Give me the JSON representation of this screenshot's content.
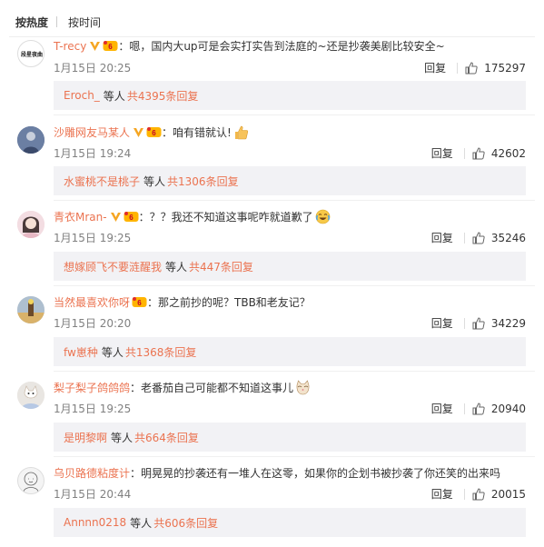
{
  "sort": {
    "hot": "按热度",
    "time": "按时间"
  },
  "comments": [
    {
      "username": "T-recy",
      "text": "：嗯，国内大up可是会实打实告到法庭的~还是抄袭美剧比较安全~",
      "time": "1月15日 20:25",
      "likes": "175297",
      "reply_label": "回复",
      "reply_user": "Eroch_",
      "reply_mid": "等人",
      "reply_count": "共4395条回复",
      "has_v": true,
      "has_vip": true,
      "emoji": "",
      "avatar_text": "段星夜曲"
    },
    {
      "username": "沙雕网友马某人",
      "text": "：咱有错就认!",
      "time": "1月15日 19:24",
      "likes": "42602",
      "reply_label": "回复",
      "reply_user": "水蜜桃不是桃子",
      "reply_mid": "等人",
      "reply_count": "共1306条回复",
      "has_v": true,
      "has_vip": true,
      "emoji": "thumbs-up-emoji",
      "avatar_text": ""
    },
    {
      "username": "青衣Mran-",
      "text": "：？？我还不知道这事呢咋就道歉了",
      "time": "1月15日 19:25",
      "likes": "35246",
      "reply_label": "回复",
      "reply_user": "想嫁顾飞不要涟醒我",
      "reply_mid": "等人",
      "reply_count": "共447条回复",
      "has_v": true,
      "has_vip": true,
      "emoji": "laugh-cry-emoji",
      "avatar_text": ""
    },
    {
      "username": "当然最喜欢你呀",
      "text": "：那之前抄的呢？TBB和老友记？",
      "time": "1月15日 20:20",
      "likes": "34229",
      "reply_label": "回复",
      "reply_user": "fw崽种",
      "reply_mid": "等人",
      "reply_count": "共1368条回复",
      "has_v": false,
      "has_vip": true,
      "emoji": "",
      "avatar_text": ""
    },
    {
      "username": "梨子梨子鸽鸽鸽",
      "text": "：老番茄自己可能都不知道这事儿",
      "time": "1月15日 19:25",
      "likes": "20940",
      "reply_label": "回复",
      "reply_user": "是明黎啊",
      "reply_mid": "等人",
      "reply_count": "共664条回复",
      "has_v": false,
      "has_vip": false,
      "emoji": "cat-emoji",
      "avatar_text": ""
    },
    {
      "username": "乌贝路德粘度计",
      "text": "：明晃晃的抄袭还有一堆人在这零，如果你的企划书被抄袭了你还笑的出来吗",
      "time": "1月15日 20:44",
      "likes": "20015",
      "reply_label": "回复",
      "reply_user": "Annnn0218",
      "reply_mid": "等人",
      "reply_count": "共606条回复",
      "has_v": false,
      "has_vip": false,
      "emoji": "",
      "avatar_text": ""
    }
  ]
}
